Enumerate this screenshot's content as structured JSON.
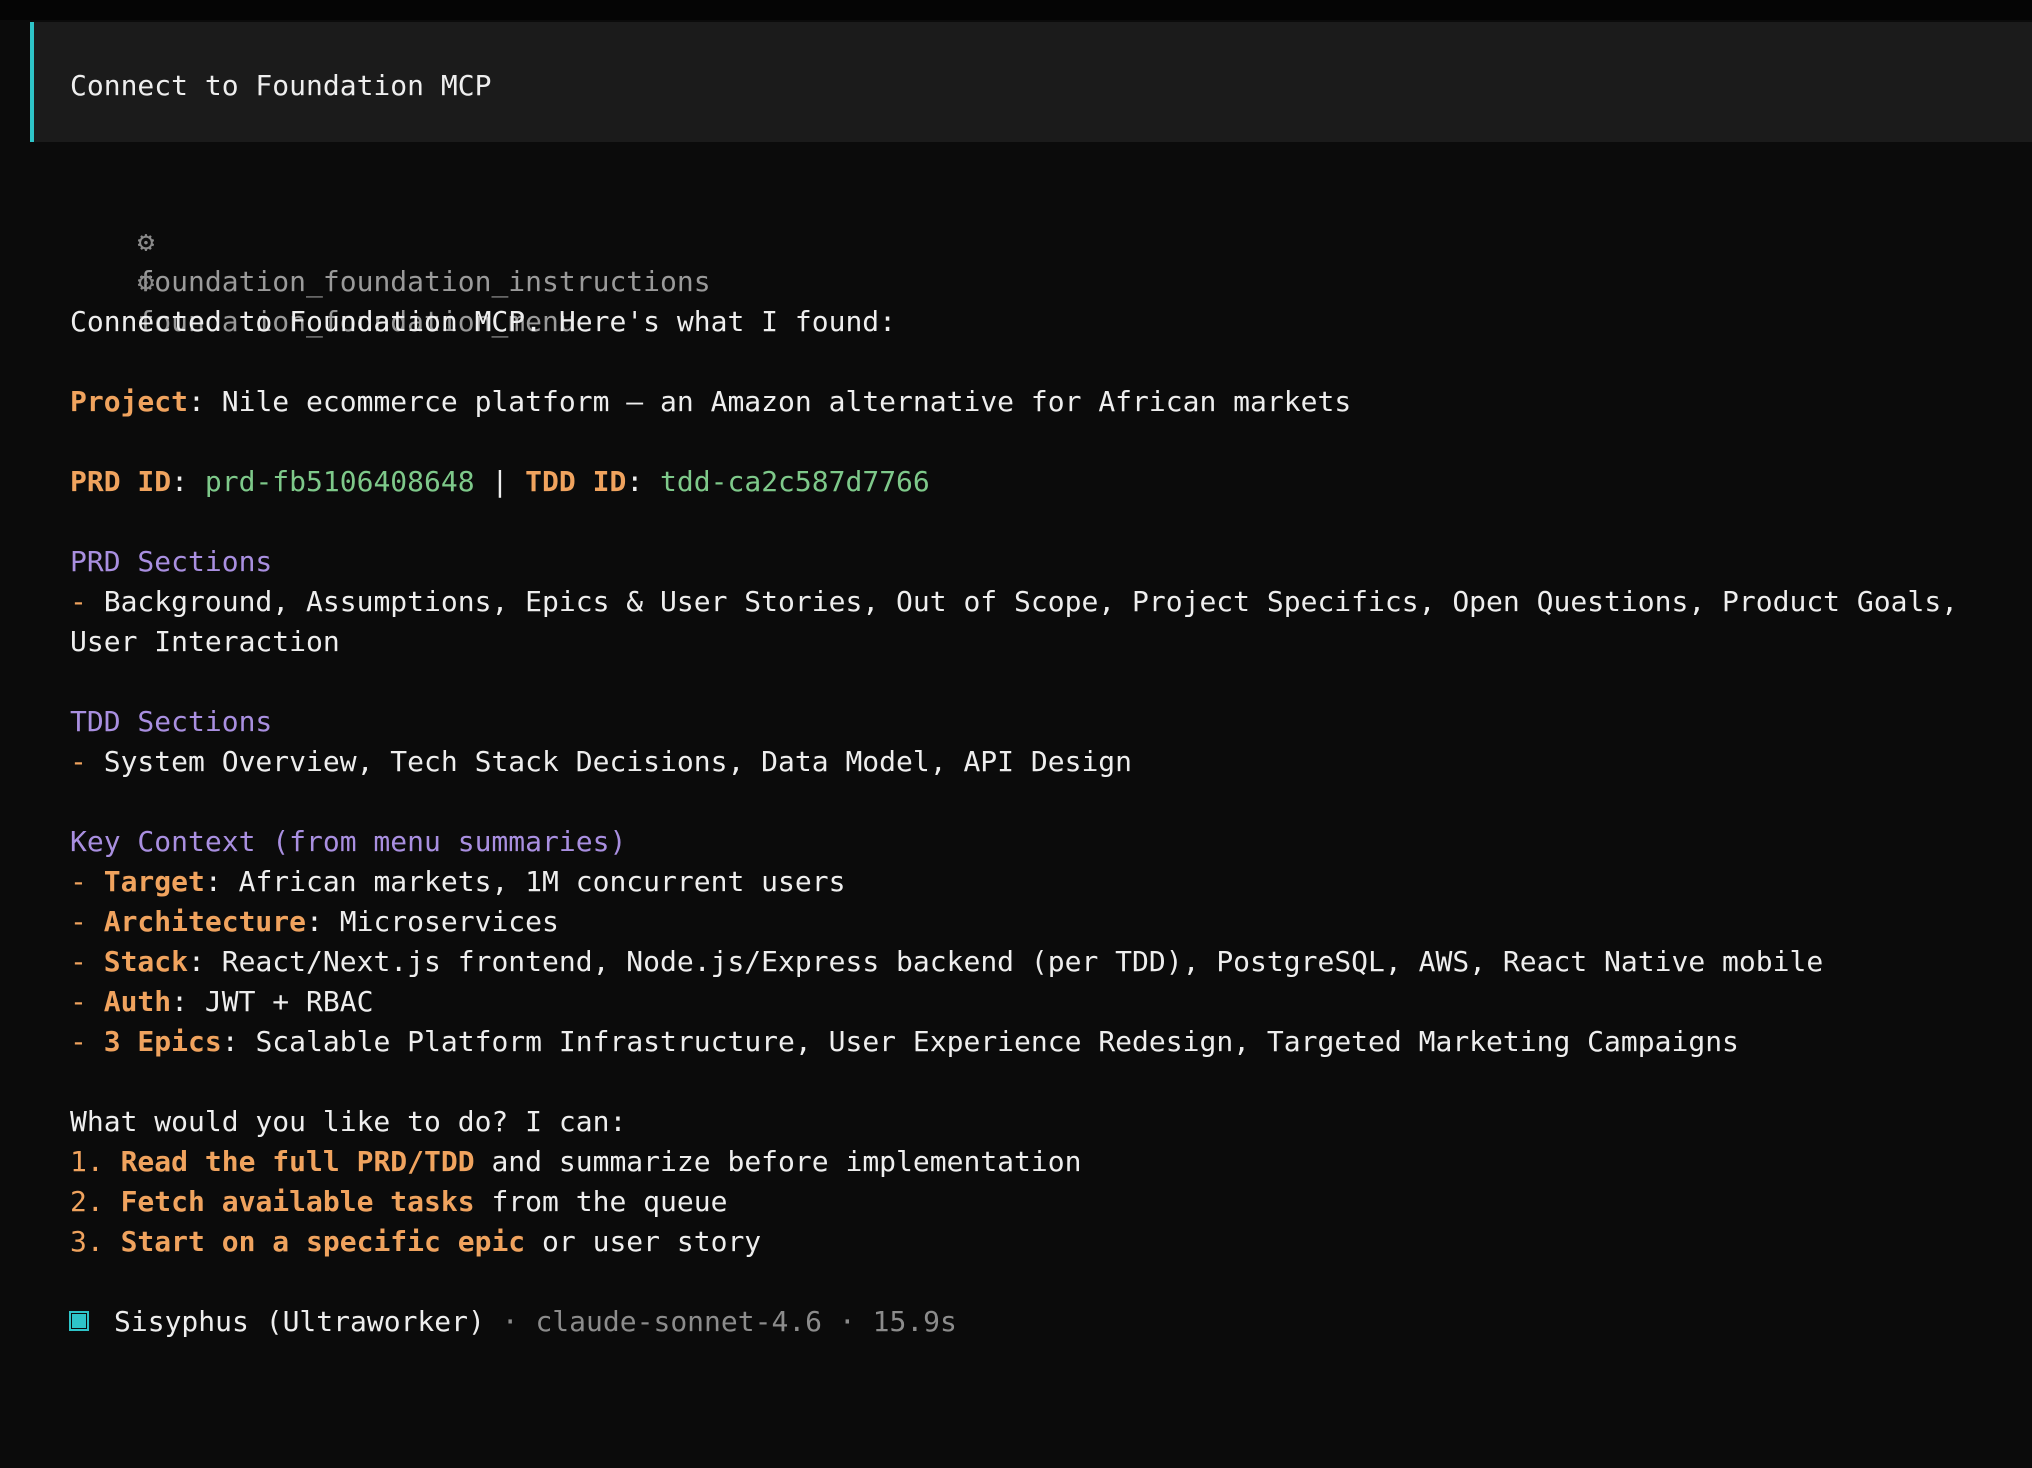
{
  "prompt": {
    "text": "Connect to Foundation MCP"
  },
  "tools": [
    {
      "icon": "gear-icon",
      "glyph": "⚙",
      "name": "foundation_foundation_instructions"
    },
    {
      "icon": "gear-icon",
      "glyph": "⚙",
      "name": "foundation_foundation_menu"
    }
  ],
  "response": {
    "intro": "Connected to Foundation MCP. Here's what I found:",
    "project_label": "Project",
    "project_value": ": Nile ecommerce platform — an Amazon alternative for African markets",
    "prd_id_label": "PRD ID",
    "prd_id_sep": ": ",
    "prd_id_value": "prd-fb5106408648",
    "pipe": " | ",
    "tdd_id_label": "TDD ID",
    "tdd_id_sep": ": ",
    "tdd_id_value": "tdd-ca2c587d7766",
    "prd_sections_heading": "PRD Sections",
    "prd_sections_dash": "- ",
    "prd_sections_text": "Background, Assumptions, Epics & User Stories, Out of Scope, Project Specifics, Open Questions, Product Goals, User Interaction",
    "tdd_sections_heading": "TDD Sections",
    "tdd_sections_dash": "- ",
    "tdd_sections_text": "System Overview, Tech Stack Decisions, Data Model, API Design",
    "key_context_heading": "Key Context (from menu summaries)",
    "key_context": [
      {
        "dash": "- ",
        "label": "Target",
        "value": ": African markets, 1M concurrent users"
      },
      {
        "dash": "- ",
        "label": "Architecture",
        "value": ": Microservices"
      },
      {
        "dash": "- ",
        "label": "Stack",
        "value": ": React/Next.js frontend, Node.js/Express backend (per TDD), PostgreSQL, AWS, React Native mobile"
      },
      {
        "dash": "- ",
        "label": "Auth",
        "value": ": JWT + RBAC"
      },
      {
        "dash": "- ",
        "label": "3 Epics",
        "value": ": Scalable Platform Infrastructure, User Experience Redesign, Targeted Marketing Campaigns"
      }
    ],
    "question": "What would you like to do? I can:",
    "options": [
      {
        "num": "1. ",
        "action": "Read the full PRD/TDD",
        "rest": " and summarize before implementation"
      },
      {
        "num": "2. ",
        "action": "Fetch available tasks",
        "rest": " from the queue"
      },
      {
        "num": "3. ",
        "action": "Start on a specific epic",
        "rest": " or user story"
      }
    ]
  },
  "footer": {
    "agent": "Sisyphus (Ultraworker)",
    "sep1": " · ",
    "model": "claude-sonnet-4.6",
    "sep2": " · ",
    "duration": "15.9s"
  },
  "colors": {
    "accent": "#2ec4c8",
    "orange": "#f0a35e",
    "green": "#7ec98a",
    "purple": "#a98fe0",
    "background": "#0b0b0b",
    "prompt_background": "#1b1b1b"
  }
}
